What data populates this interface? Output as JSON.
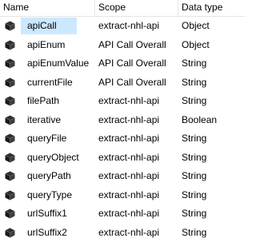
{
  "columns": {
    "name": "Name",
    "scope": "Scope",
    "data_type": "Data type"
  },
  "variables": [
    {
      "name": "apiCall",
      "scope": "extract-nhl-api",
      "data_type": "Object"
    },
    {
      "name": "apiEnum",
      "scope": "API Call Overall",
      "data_type": "Object"
    },
    {
      "name": "apiEnumValue",
      "scope": "API Call Overall",
      "data_type": "String"
    },
    {
      "name": "currentFile",
      "scope": "API Call Overall",
      "data_type": "String"
    },
    {
      "name": "filePath",
      "scope": "extract-nhl-api",
      "data_type": "String"
    },
    {
      "name": "iterative",
      "scope": "extract-nhl-api",
      "data_type": "Boolean"
    },
    {
      "name": "queryFile",
      "scope": "extract-nhl-api",
      "data_type": "String"
    },
    {
      "name": "queryObject",
      "scope": "extract-nhl-api",
      "data_type": "String"
    },
    {
      "name": "queryPath",
      "scope": "extract-nhl-api",
      "data_type": "String"
    },
    {
      "name": "queryType",
      "scope": "extract-nhl-api",
      "data_type": "String"
    },
    {
      "name": "urlSuffix1",
      "scope": "extract-nhl-api",
      "data_type": "String"
    },
    {
      "name": "urlSuffix2",
      "scope": "extract-nhl-api",
      "data_type": "String"
    }
  ],
  "row_icon": "variable-cube-icon",
  "colors": {
    "selection": "#cce8ff",
    "grid_line": "#e5e5e5"
  }
}
